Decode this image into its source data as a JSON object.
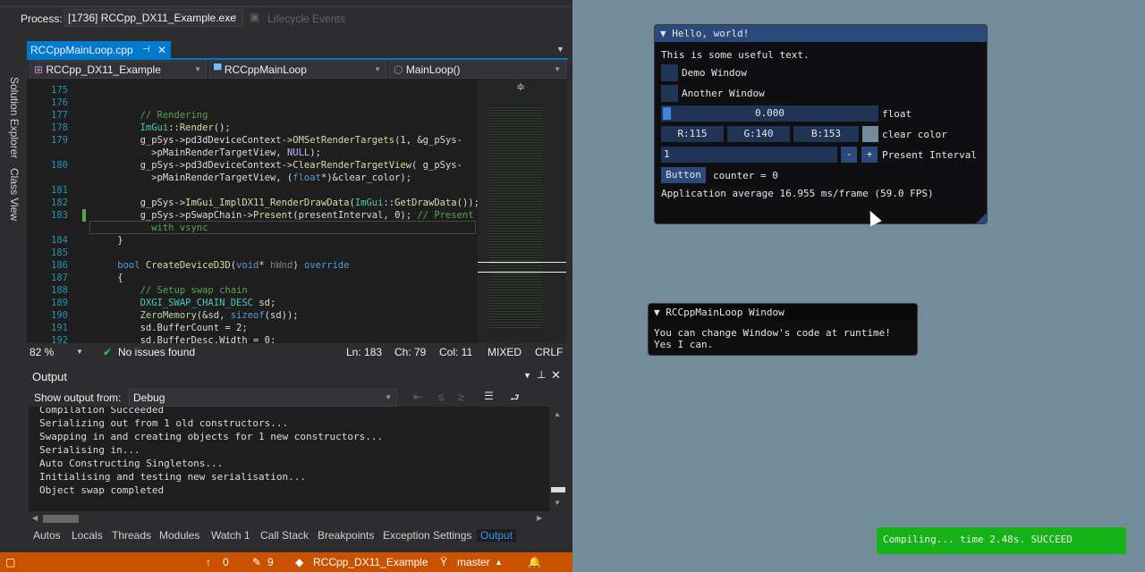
{
  "toolbar": {
    "process_label": "Process:",
    "process_value": "[1736] RCCpp_DX11_Example.exe",
    "lifecycle": "Lifecycle Events"
  },
  "side_tabs": [
    "Solution Explorer",
    "Class View"
  ],
  "editor": {
    "tab": "RCCppMainLoop.cpp",
    "nav": {
      "project": "RCCpp_DX11_Example",
      "class": "RCCppMainLoop",
      "member": "MainLoop()"
    },
    "lines": [
      {
        "n": "175",
        "tokens": []
      },
      {
        "n": "176",
        "tokens": []
      },
      {
        "n": "177",
        "tokens": [
          {
            "c": "c",
            "t": "        // Rendering"
          }
        ]
      },
      {
        "n": "178",
        "tokens": [
          {
            "c": "p",
            "t": "        "
          },
          {
            "c": "t",
            "t": "ImGui"
          },
          {
            "c": "p",
            "t": "::"
          },
          {
            "c": "f",
            "t": "Render"
          },
          {
            "c": "p",
            "t": "();"
          }
        ]
      },
      {
        "n": "179",
        "tokens": [
          {
            "c": "p",
            "t": "        g_pSys->pd3dDeviceContext->"
          },
          {
            "c": "f",
            "t": "OMSetRenderTargets"
          },
          {
            "c": "p",
            "t": "(1, &g_pSys-"
          }
        ]
      },
      {
        "n": "",
        "tokens": [
          {
            "c": "p",
            "t": "          >pMainRenderTargetView, "
          },
          {
            "c": "mac",
            "t": "NULL"
          },
          {
            "c": "p",
            "t": ");"
          }
        ]
      },
      {
        "n": "180",
        "tokens": [
          {
            "c": "p",
            "t": "        g_pSys->pd3dDeviceContext->"
          },
          {
            "c": "f",
            "t": "ClearRenderTargetView"
          },
          {
            "c": "p",
            "t": "( g_pSys-"
          }
        ]
      },
      {
        "n": "",
        "tokens": [
          {
            "c": "p",
            "t": "          >pMainRenderTargetView, ("
          },
          {
            "c": "k",
            "t": "float"
          },
          {
            "c": "p",
            "t": "*)&clear_color);"
          }
        ]
      },
      {
        "n": "181",
        "tokens": []
      },
      {
        "n": "182",
        "tokens": [
          {
            "c": "p",
            "t": "        g_pSys->"
          },
          {
            "c": "f",
            "t": "ImGui_ImplDX11_RenderDrawData"
          },
          {
            "c": "p",
            "t": "("
          },
          {
            "c": "t",
            "t": "ImGui"
          },
          {
            "c": "p",
            "t": "::"
          },
          {
            "c": "f",
            "t": "GetDrawData"
          },
          {
            "c": "p",
            "t": "());"
          }
        ]
      },
      {
        "n": "183",
        "tokens": [
          {
            "c": "p",
            "t": "        g_pSys->pSwapChain->"
          },
          {
            "c": "f",
            "t": "Present"
          },
          {
            "c": "p",
            "t": "(presentInterval, 0); "
          },
          {
            "c": "c",
            "t": "// Present"
          }
        ]
      },
      {
        "n": "",
        "tokens": [
          {
            "c": "c",
            "t": "          with vsync"
          }
        ]
      },
      {
        "n": "184",
        "tokens": [
          {
            "c": "p",
            "t": "    }"
          }
        ]
      },
      {
        "n": "185",
        "tokens": []
      },
      {
        "n": "186",
        "tokens": [
          {
            "c": "k",
            "t": "    bool "
          },
          {
            "c": "f",
            "t": "CreateDeviceD3D"
          },
          {
            "c": "p",
            "t": "("
          },
          {
            "c": "k",
            "t": "void"
          },
          {
            "c": "p",
            "t": "* "
          },
          {
            "c": "g",
            "t": "hWnd"
          },
          {
            "c": "p",
            "t": ") "
          },
          {
            "c": "k",
            "t": "override"
          }
        ]
      },
      {
        "n": "187",
        "tokens": [
          {
            "c": "p",
            "t": "    {"
          }
        ]
      },
      {
        "n": "188",
        "tokens": [
          {
            "c": "c",
            "t": "        // Setup swap chain"
          }
        ]
      },
      {
        "n": "189",
        "tokens": [
          {
            "c": "t",
            "t": "        DXGI_SWAP_CHAIN_DESC"
          },
          {
            "c": "p",
            "t": " sd;"
          }
        ]
      },
      {
        "n": "190",
        "tokens": [
          {
            "c": "m",
            "t": "        ZeroMemory"
          },
          {
            "c": "p",
            "t": "(&sd, "
          },
          {
            "c": "k",
            "t": "sizeof"
          },
          {
            "c": "p",
            "t": "(sd));"
          }
        ]
      },
      {
        "n": "191",
        "tokens": [
          {
            "c": "p",
            "t": "        sd.BufferCount = 2;"
          }
        ]
      },
      {
        "n": "192",
        "tokens": [
          {
            "c": "p",
            "t": "        sd.BufferDesc.Width = 0;"
          }
        ]
      }
    ],
    "status": {
      "zoom": "82 %",
      "issues": "No issues found",
      "ln": "Ln: 183",
      "ch": "Ch: 79",
      "col": "Col: 11",
      "encoding": "MIXED",
      "eol": "CRLF"
    }
  },
  "output": {
    "title": "Output",
    "show_from_label": "Show output from:",
    "source": "Debug",
    "lines": [
      "Compilation Succeeded",
      "Serializing out from 1 old constructors...",
      "Swapping in and creating objects for 1 new constructors...",
      "Serialising in...",
      "Auto Constructing Singletons...",
      "Initialising and testing new serialisation...",
      "Object swap completed"
    ]
  },
  "bottom_tabs": [
    "Autos",
    "Locals",
    "Threads",
    "Modules",
    "Watch 1",
    "Call Stack",
    "Breakpoints",
    "Exception Settings",
    "Output"
  ],
  "statusbar": {
    "up": "0",
    "edits": "9",
    "repo": "RCCpp_DX11_Example",
    "branch": "master",
    "color": "#ca5100"
  },
  "hello": {
    "title": "Hello, world!",
    "text": "This is some useful text.",
    "demo": "Demo Window",
    "another": "Another Window",
    "slider_value": "0.000",
    "slider_label": "float",
    "slider_fraction": 0,
    "r": "R:115",
    "g": "G:140",
    "b": "B:153",
    "color_label": "clear color",
    "clear_color": "#738c99",
    "interval_value": "1",
    "minus": "-",
    "plus": "+",
    "interval_label": "Present Interval",
    "button": "Button",
    "counter": "counter = 0",
    "fps": "Application average 16.955 ms/frame (59.0 FPS)"
  },
  "mainloop": {
    "title": "RCCppMainLoop Window",
    "line1": "You can change Window's code at runtime!",
    "line2": "Yes I can."
  },
  "toast": {
    "text": "Compiling... time 2.48s. SUCCEED",
    "color": "#17b217"
  }
}
